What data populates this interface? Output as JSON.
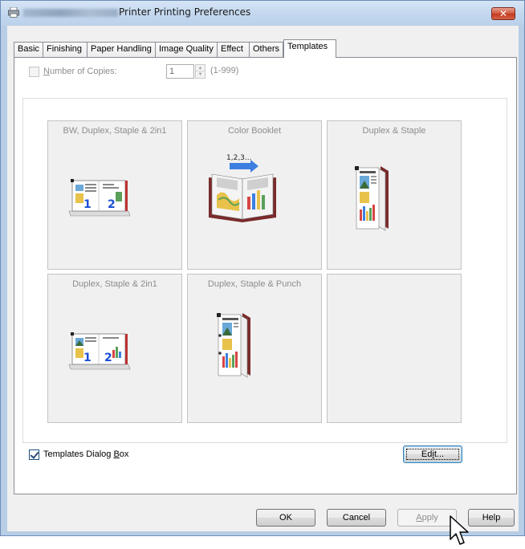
{
  "window": {
    "title": "Printer Printing Preferences",
    "close_label": "✕"
  },
  "tabs": [
    {
      "label": "Basic"
    },
    {
      "label": "Finishing"
    },
    {
      "label": "Paper Handling"
    },
    {
      "label": "Image Quality"
    },
    {
      "label": "Effect"
    },
    {
      "label": "Others"
    },
    {
      "label": "Templates",
      "active": true
    }
  ],
  "copies": {
    "label_pre": "",
    "label_mnemonic": "N",
    "label_rest": "umber of Copies:",
    "value": "1",
    "range": "(1-999)",
    "checked": false,
    "enabled": false
  },
  "templates": [
    {
      "label": "BW, Duplex, Staple & 2in1",
      "icon": "bw-duplex-staple-2in1-icon"
    },
    {
      "label": "Color Booklet",
      "icon": "color-booklet-icon",
      "badge": "1,2,3..."
    },
    {
      "label": "Duplex & Staple",
      "icon": "duplex-staple-icon"
    },
    {
      "label": "Duplex, Staple & 2in1",
      "icon": "duplex-staple-2in1-icon"
    },
    {
      "label": "Duplex, Staple & Punch",
      "icon": "duplex-staple-punch-icon"
    },
    {
      "label": "",
      "icon": ""
    }
  ],
  "templates_dialog": {
    "label_pre": "Templates Dialog ",
    "label_mnemonic": "B",
    "label_rest": "ox",
    "checked": true
  },
  "edit_button": {
    "pre": "Ed",
    "mnemonic": "i",
    "rest": "t..."
  },
  "footer": {
    "ok": "OK",
    "cancel": "Cancel",
    "apply_mnemonic": "A",
    "apply_rest": "pply",
    "help": "Help"
  },
  "colors": {
    "close": "#c23b22",
    "focus_border": "#3c7fb1",
    "tile_bg": "#f0f0f0",
    "disabled_text": "#8d8d8d"
  }
}
